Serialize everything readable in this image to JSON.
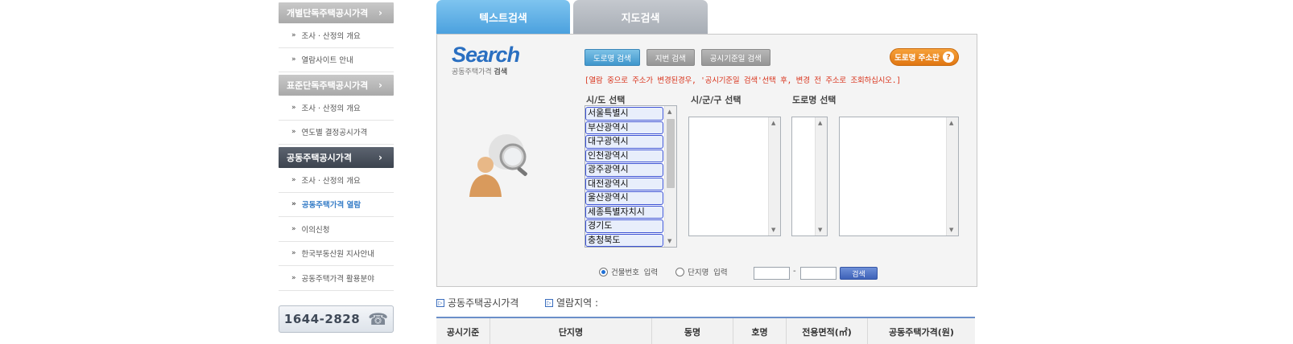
{
  "sidebar": {
    "sections": [
      {
        "title": "개별단독주택공시가격",
        "active": false,
        "items": [
          {
            "label": "조사 · 산정의 개요",
            "current": false
          },
          {
            "label": "열람사이트 안내",
            "current": false
          }
        ]
      },
      {
        "title": "표준단독주택공시가격",
        "active": false,
        "items": [
          {
            "label": "조사 · 산정의 개요",
            "current": false
          },
          {
            "label": "연도별 결정공시가격",
            "current": false
          }
        ]
      },
      {
        "title": "공동주택공시가격",
        "active": true,
        "items": [
          {
            "label": "조사 · 산정의 개요",
            "current": false
          },
          {
            "label": "공동주택가격 열람",
            "current": true
          },
          {
            "label": "이의신청",
            "current": false
          },
          {
            "label": "한국부동산원 지사안내",
            "current": false
          },
          {
            "label": "공동주택가격 활용분야",
            "current": false
          }
        ]
      }
    ],
    "chevron": "›",
    "bullet": "»",
    "phone": "1644-2828",
    "phone_icon": "telephone-icon"
  },
  "tabs": {
    "text_search": "텍스트검색",
    "map_search": "지도검색"
  },
  "search": {
    "logo_big": "Search",
    "logo_small_pre": "공동주택가격 ",
    "logo_small_bold": "검색",
    "buttons": {
      "road": "도로명 검색",
      "lot": "지번 검색",
      "date": "공시기준일 검색"
    },
    "help_label": "도로명 주소란",
    "help_icon": "?",
    "notice": "[열람 중으로 주소가 변경된경우, '공시기준일 검색'선택 후, 변경 전 주소로 조회하십시오.]",
    "labels": {
      "sido": "시/도 선택",
      "sigungu": "시/군/구 선택",
      "road": "도로명 선택"
    },
    "sido_options": [
      "서울특별시",
      "부산광역시",
      "대구광역시",
      "인천광역시",
      "광주광역시",
      "대전광역시",
      "울산광역시",
      "세종특별자치시",
      "경기도",
      "충청북도"
    ],
    "radio_building": "건물번호 입력",
    "radio_complex": "단지명 입력",
    "dash": "-",
    "go": "검색"
  },
  "bottom": {
    "title": "공동주택공시가격",
    "region_label": "열람지역 :",
    "columns": [
      "공시기준",
      "단지명",
      "동명",
      "호명",
      "전용면적(㎡)",
      "공동주택가격(원)"
    ]
  },
  "colors": {
    "accent": "#3a7fc8",
    "tab_active": "#4aa0de",
    "notice": "#d9341c",
    "help": "#e07612"
  }
}
